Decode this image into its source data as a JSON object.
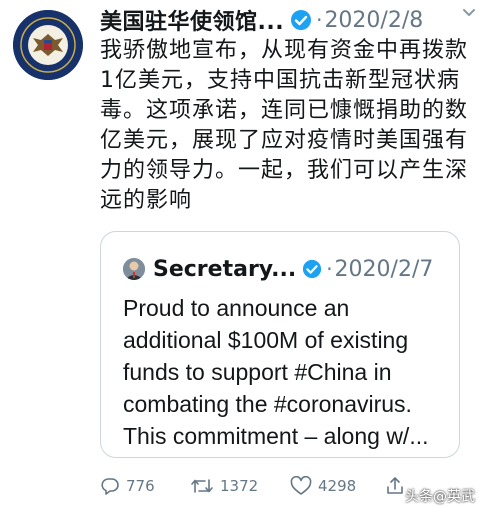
{
  "tweet": {
    "author": "美国驻华使领馆...",
    "separator": "·",
    "date": "2020/2/8",
    "text": "我骄傲地宣布，从现有资金中再拨款1亿美元，支持中国抗击新型冠状病毒。这项承诺，连同已慷慨捐助的数亿美元，展现了应对疫情时美国强有力的领导力。一起，我们可以产生深远的影响",
    "caret_icon": "chevron-down-icon",
    "verified_color": "#1da1f2"
  },
  "quoted_tweet": {
    "author": "Secretary...",
    "separator": "·",
    "date": "2020/2/7",
    "text": "Proud to announce an additional $100M of existing funds to support #China in combating the #coronavirus. This commitment – along w/..."
  },
  "actions": {
    "replies": "776",
    "retweets": "1372",
    "likes": "4298"
  },
  "watermark": "头条@英武",
  "colors": {
    "text": "#14171a",
    "muted": "#657786",
    "border": "#ccd6dd",
    "avatar_bg": "#17326b"
  }
}
